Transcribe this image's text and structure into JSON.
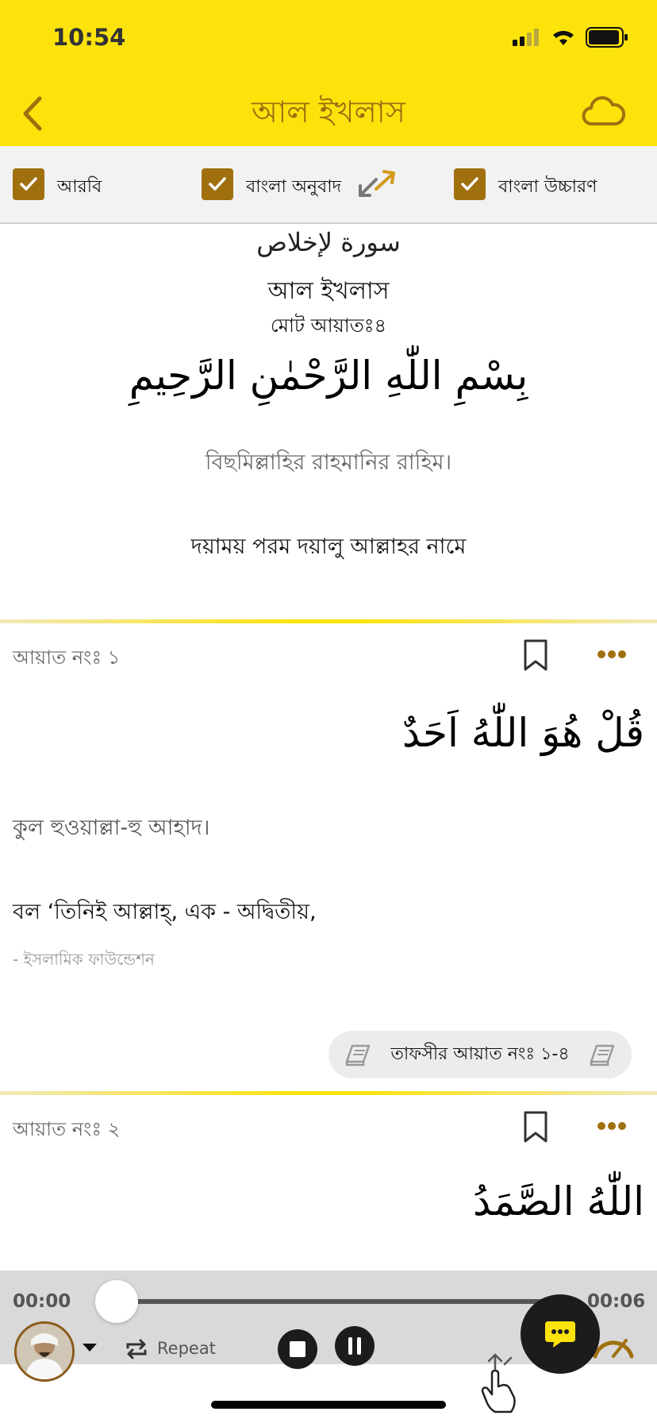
{
  "status_bar": {
    "time": "10:54"
  },
  "header": {
    "title": "আল ইখলাস"
  },
  "toggles": [
    {
      "label": "আরবি",
      "checked": true
    },
    {
      "label": "বাংলা অনুবাদ",
      "checked": true
    },
    {
      "label": "বাংলা উচ্চারণ",
      "checked": true
    }
  ],
  "intro": {
    "surah_arabic": "سورة لإخلاص",
    "surah_bangla": "আল ইখলাস",
    "total_ayat": "মোট আয়াতঃ৪",
    "bismillah_arabic": "بِسْمِ اللّٰهِ الرَّحْمٰنِ الرَّحِيمِ",
    "bismillah_pron": "বিছমিল্লাহির রাহমানির রাহিম।",
    "bismillah_trans": "দয়াময় পরম দয়ালু আল্লাহর নামে"
  },
  "ayahs": [
    {
      "label": "আয়াত নংঃ ১",
      "arabic": "قُلْ هُوَ اللّٰهُ اَحَدٌ",
      "pron": "কুল হুওয়াল্লা-হু আহাদ।",
      "trans": "বল ‘তিনিই আল্লাহ্‌, এক - অদ্বিতীয়,",
      "source": "- ইসলামিক ফাউন্ডেশন",
      "tafsir": "তাফসীর আয়াত নংঃ ১-৪"
    },
    {
      "label": "আয়াত নংঃ ২",
      "arabic": "اللّٰهُ الصَّمَدُ"
    }
  ],
  "player": {
    "current_time": "00:00",
    "total_time": "00:06",
    "repeat_label": "Repeat",
    "progress": 0
  },
  "colors": {
    "header_bg": "#FDE30C",
    "accent": "#A0700F",
    "title": "#9a6d10"
  }
}
